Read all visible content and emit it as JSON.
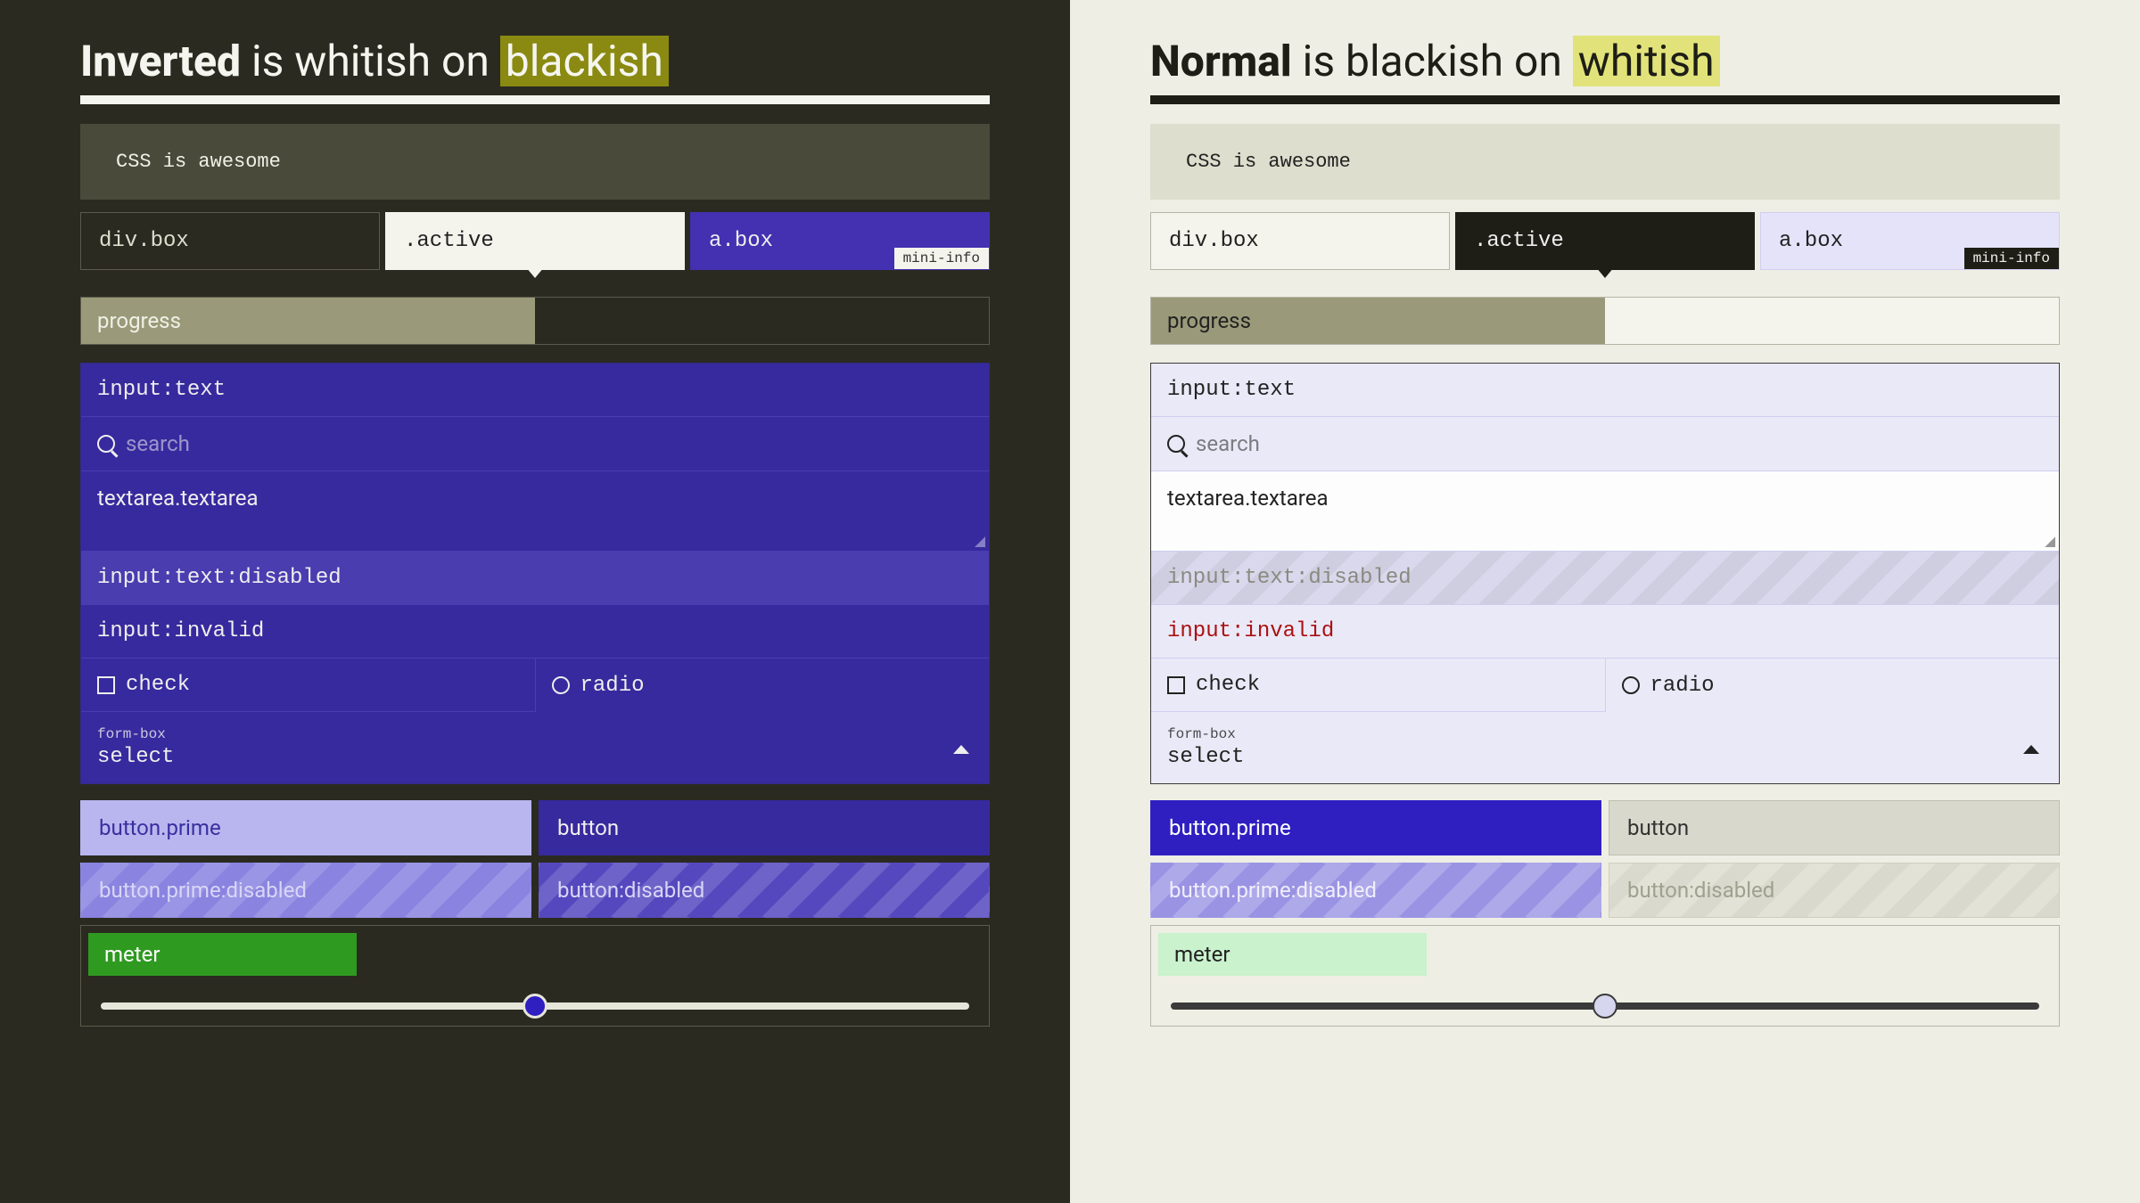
{
  "inverted": {
    "title_bold": "Inverted",
    "title_mid": " is whitish on ",
    "title_hi": "blackish",
    "demo_text": "CSS is awesome",
    "tabs": {
      "t1": "div.box",
      "t2": ".active",
      "t3": "a.box",
      "mini": "mini-info"
    },
    "progress_label": "progress",
    "progress_pct": 50,
    "input_text": "input:text",
    "search_placeholder": "search",
    "textarea_text": "textarea.textarea",
    "input_disabled": "input:text:disabled",
    "input_invalid": "input:invalid",
    "check_label": "check",
    "radio_label": "radio",
    "select_caption": "form-box",
    "select_value": "select",
    "btn_prime": "button.prime",
    "btn_plain": "button",
    "btn_prime_dis": "button.prime:disabled",
    "btn_plain_dis": "button:disabled",
    "meter_label": "meter",
    "meter_pct": 30,
    "slider_pct": 50
  },
  "normal": {
    "title_bold": "Normal",
    "title_mid": " is blackish on ",
    "title_hi": "whitish",
    "demo_text": "CSS is awesome",
    "tabs": {
      "t1": "div.box",
      "t2": ".active",
      "t3": "a.box",
      "mini": "mini-info"
    },
    "progress_label": "progress",
    "progress_pct": 50,
    "input_text": "input:text",
    "search_placeholder": "search",
    "textarea_text": "textarea.textarea",
    "input_disabled": "input:text:disabled",
    "input_invalid": "input:invalid",
    "check_label": "check",
    "radio_label": "radio",
    "select_caption": "form-box",
    "select_value": "select",
    "btn_prime": "button.prime",
    "btn_plain": "button",
    "btn_prime_dis": "button.prime:disabled",
    "btn_plain_dis": "button:disabled",
    "meter_label": "meter",
    "meter_pct": 30,
    "slider_pct": 50
  },
  "colors": {
    "dark_bg": "#2b2a21",
    "light_bg": "#eeeee4",
    "indigo": "#372a9e",
    "indigo_alt": "#4331b1",
    "prime_light": "#b9b6ef",
    "prime_dark": "#2f1fc0",
    "olive": "#9a9a7a",
    "green_inv": "#2e9a20",
    "green_nor": "#c9f2cd",
    "hi_inv": "#8a8a12",
    "hi_nor": "#e1e37a"
  }
}
